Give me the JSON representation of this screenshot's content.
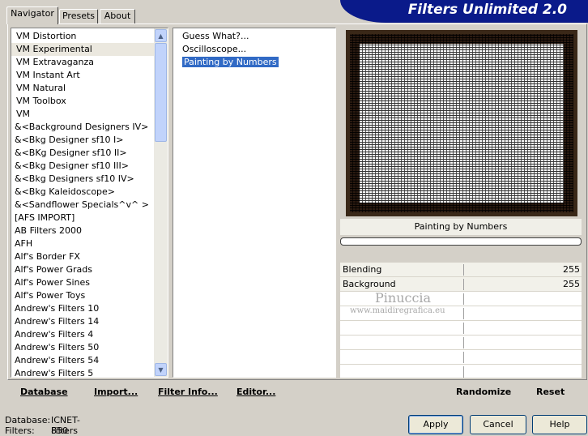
{
  "tabs": [
    "Navigator",
    "Presets",
    "About"
  ],
  "banner_title": "Filters Unlimited 2.0",
  "categories": [
    "VM Distortion",
    "VM Experimental",
    "VM Extravaganza",
    "VM Instant Art",
    "VM Natural",
    "VM Toolbox",
    "VM",
    "&<Background Designers IV>",
    "&<Bkg Designer sf10 I>",
    "&<BKg Designer sf10 II>",
    "&<Bkg Designer sf10 III>",
    "&<Bkg Designers sf10 IV>",
    "&<Bkg Kaleidoscope>",
    "&<Sandflower Specials^v^ >",
    "[AFS IMPORT]",
    "AB Filters 2000",
    "AFH",
    "Alf's Border FX",
    "Alf's Power Grads",
    "Alf's Power Sines",
    "Alf's Power Toys",
    "Andrew's Filters 10",
    "Andrew's Filters 14",
    "Andrew's Filters 4",
    "Andrew's Filters 50",
    "Andrew's Filters 54",
    "Andrew's Filters 5"
  ],
  "filters": [
    "Guess  What?...",
    "Oscilloscope...",
    "Painting by Numbers"
  ],
  "left_actions": {
    "database": "Database",
    "import": "Import...",
    "filter_info": "Filter Info...",
    "editor": "Editor..."
  },
  "right_actions": {
    "randomize": "Randomize",
    "reset": "Reset"
  },
  "selected_filter_name": "Painting by Numbers",
  "params": [
    {
      "label": "Blending",
      "value": "255"
    },
    {
      "label": "Background",
      "value": "255"
    }
  ],
  "watermark": {
    "name": "Pinuccia",
    "url": "www.maidiregrafica.eu"
  },
  "status": {
    "database_label": "Database:",
    "database_value": "ICNET-Filters",
    "filters_label": "Filters:",
    "filters_value": "850"
  },
  "buttons": {
    "apply": "Apply",
    "cancel": "Cancel",
    "help": "Help"
  },
  "colors": {
    "banner": "#0a1a8a",
    "selection": "#316ac5"
  }
}
